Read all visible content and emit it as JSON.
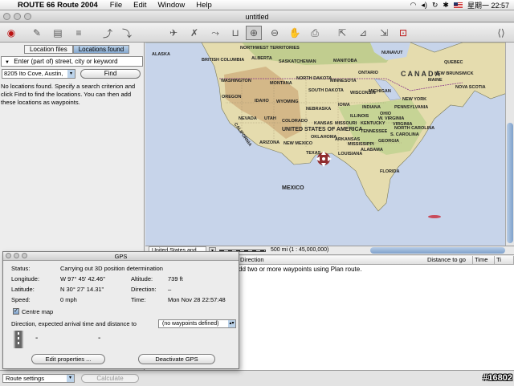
{
  "menubar": {
    "app_name": "ROUTE 66 Route 2004",
    "menus": [
      "File",
      "Edit",
      "Window",
      "Help"
    ],
    "clock": "星期一 22:57"
  },
  "window": {
    "title": "untitled"
  },
  "left_panel": {
    "tabs": [
      "Location files",
      "Locations found"
    ],
    "search_placeholder": "Enter (part of) street, city or keyword",
    "address_value": "8205 Ito Cove, Austin,",
    "find_button": "Find",
    "message": "No locations found. Specify a search criterion and click Find to find the locations. You can then add these locations as waypoints."
  },
  "map": {
    "labels": {
      "alaska": "ALASKA",
      "nunavut": "NUNAVUT",
      "nwt": "NORTHWEST TERRITORIES",
      "bc": "BRITISH COLUMBIA",
      "alberta": "ALBERTA",
      "sask": "SASKATCHEWAN",
      "manitoba": "MANITOBA",
      "ontario": "ONTARIO",
      "quebec": "QUEBEC",
      "canada": "CANADA",
      "washington": "WASHINGTON",
      "oregon": "OREGON",
      "idaho": "IDAHO",
      "montana": "MONTANA",
      "wyoming": "WYOMING",
      "nevada": "NEVADA",
      "utah": "UTAH",
      "california": "CALIFORNIA",
      "arizona": "ARIZONA",
      "colorado": "COLORADO",
      "newmexico": "NEW MEXICO",
      "nd": "NORTH DAKOTA",
      "sd": "SOUTH DAKOTA",
      "nebraska": "NEBRASKA",
      "kansas": "KANSAS",
      "oklahoma": "OKLAHOMA",
      "texas": "TEXAS",
      "minnesota": "MINNESOTA",
      "iowa": "IOWA",
      "missouri": "MISSOURI",
      "arkansas": "ARKANSAS",
      "louisiana": "LOUISIANA",
      "wisconsin": "WISCONSIN",
      "illinois": "ILLINOIS",
      "michigan": "MICHIGAN",
      "indiana": "INDIANA",
      "ohio": "OHIO",
      "kentucky": "KENTUCKY",
      "tennessee": "TENNESSEE",
      "mississippi": "MISSISSIPPI",
      "alabama": "ALABAMA",
      "georgia": "GEORGIA",
      "florida": "FLORIDA",
      "sc": "S. CAROLINA",
      "nc": "NORTH CAROLINA",
      "virginia": "VIRGINIA",
      "wv": "W. VIRGINIA",
      "penn": "PENNSYLVANIA",
      "newyork": "NEW YORK",
      "maine": "MAINE",
      "nb": "NEW BRUNSWICK",
      "ns": "NOVA SCOTIA",
      "usa": "UNITED STATES OF AMERICA",
      "mexico": "MEXICO"
    },
    "region_select": "United States and C...",
    "scale_text": "500 mi (1 : 45,000,000)"
  },
  "route_table": {
    "columns": [
      "Direction",
      "Distance to go",
      "Time",
      "Ti"
    ],
    "message": "dd two or more waypoints using Plan route."
  },
  "gps": {
    "title": "GPS",
    "status_label": "Status:",
    "status_value": "Carrying out 3D position determination",
    "longitude_label": "Longitude:",
    "longitude_value": "W 97° 45' 42.46\"",
    "altitude_label": "Altitude:",
    "altitude_value": "739 ft",
    "latitude_label": "Latitude:",
    "latitude_value": "N 30° 27' 14.31\"",
    "direction_label": "Direction:",
    "direction_value": "–",
    "speed_label": "Speed:",
    "speed_value": "0 mph",
    "time_label": "Time:",
    "time_value": "Mon Nov 28 22:57:48",
    "centre_map_label": "Centre map",
    "direction_eta_label": "Direction, expected arrival time and distance to",
    "waypoint_select": "(no waypoints defined)",
    "dash_1": "-",
    "dash_2": "-",
    "edit_button": "Edit properties ...",
    "deactivate_button": "Deactivate GPS"
  },
  "bottom": {
    "route_settings": "Route settings",
    "calculate_button": "Calculate",
    "watermark": "#16802"
  }
}
